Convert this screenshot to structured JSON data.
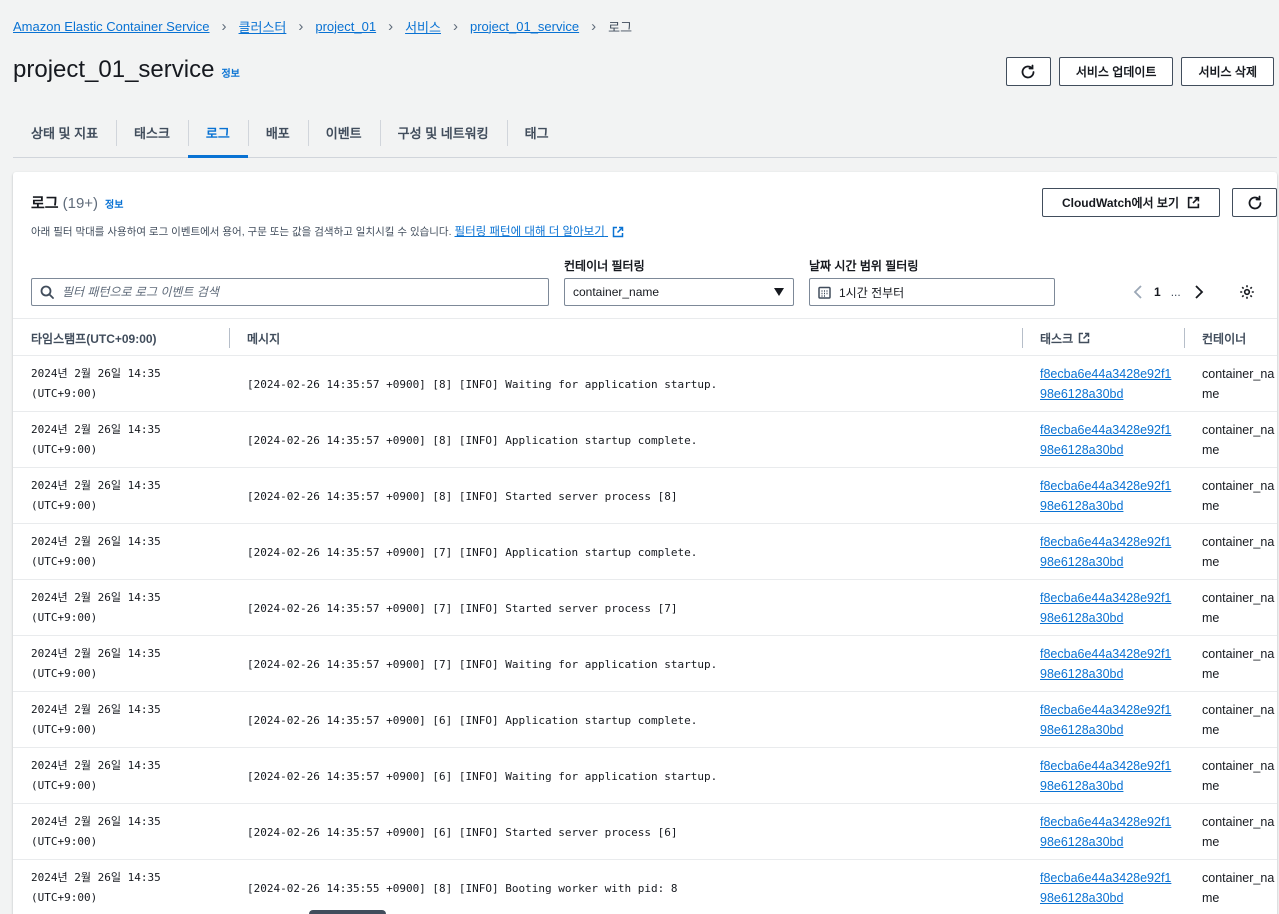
{
  "breadcrumb": {
    "items": [
      "Amazon Elastic Container Service",
      "클러스터",
      "project_01",
      "서비스",
      "project_01_service"
    ],
    "current": "로그"
  },
  "page": {
    "title": "project_01_service",
    "info": "정보"
  },
  "header_actions": {
    "update": "서비스 업데이트",
    "delete": "서비스 삭제"
  },
  "tabs": [
    "상태 및 지표",
    "태스크",
    "로그",
    "배포",
    "이벤트",
    "구성 및 네트워킹",
    "태그"
  ],
  "active_tab": "로그",
  "logs": {
    "title": "로그",
    "count": "(19+)",
    "info": "정보",
    "description": "아래 필터 막대를 사용하여 로그 이벤트에서 용어, 구문 또는 값을 검색하고 일치시킬 수 있습니다.",
    "learn_more": "필터링 패턴에 대해 더 알아보기",
    "cloudwatch_button": "CloudWatch에서 보기",
    "search_placeholder": "필터 패턴으로 로그 이벤트 검색",
    "container_filter_label": "컨테이너 필터링",
    "container_filter_value": "container_name",
    "date_filter_label": "날짜 시간 범위 필터링",
    "date_filter_value": "1시간 전부터",
    "pagination": {
      "page": "1",
      "dots": "..."
    },
    "columns": {
      "timestamp": "타임스탬프(UTC+09:00)",
      "message": "메시지",
      "task": "태스크",
      "container": "컨테이너"
    },
    "rows": [
      {
        "date": "2024년 2월 26일 14:35",
        "tz": "(UTC+9:00)",
        "message": "[2024-02-26 14:35:57 +0900] [8] [INFO] Waiting for application startup.",
        "task": "f8ecba6e44a3428e92f198e6128a30bd",
        "container": "container_name"
      },
      {
        "date": "2024년 2월 26일 14:35",
        "tz": "(UTC+9:00)",
        "message": "[2024-02-26 14:35:57 +0900] [8] [INFO] Application startup complete.",
        "task": "f8ecba6e44a3428e92f198e6128a30bd",
        "container": "container_name"
      },
      {
        "date": "2024년 2월 26일 14:35",
        "tz": "(UTC+9:00)",
        "message": "[2024-02-26 14:35:57 +0900] [8] [INFO] Started server process [8]",
        "task": "f8ecba6e44a3428e92f198e6128a30bd",
        "container": "container_name"
      },
      {
        "date": "2024년 2월 26일 14:35",
        "tz": "(UTC+9:00)",
        "message": "[2024-02-26 14:35:57 +0900] [7] [INFO] Application startup complete.",
        "task": "f8ecba6e44a3428e92f198e6128a30bd",
        "container": "container_name"
      },
      {
        "date": "2024년 2월 26일 14:35",
        "tz": "(UTC+9:00)",
        "message": "[2024-02-26 14:35:57 +0900] [7] [INFO] Started server process [7]",
        "task": "f8ecba6e44a3428e92f198e6128a30bd",
        "container": "container_name"
      },
      {
        "date": "2024년 2월 26일 14:35",
        "tz": "(UTC+9:00)",
        "message": "[2024-02-26 14:35:57 +0900] [7] [INFO] Waiting for application startup.",
        "task": "f8ecba6e44a3428e92f198e6128a30bd",
        "container": "container_name"
      },
      {
        "date": "2024년 2월 26일 14:35",
        "tz": "(UTC+9:00)",
        "message": "[2024-02-26 14:35:57 +0900] [6] [INFO] Application startup complete.",
        "task": "f8ecba6e44a3428e92f198e6128a30bd",
        "container": "container_name"
      },
      {
        "date": "2024년 2월 26일 14:35",
        "tz": "(UTC+9:00)",
        "message": "[2024-02-26 14:35:57 +0900] [6] [INFO] Waiting for application startup.",
        "task": "f8ecba6e44a3428e92f198e6128a30bd",
        "container": "container_name"
      },
      {
        "date": "2024년 2월 26일 14:35",
        "tz": "(UTC+9:00)",
        "message": "[2024-02-26 14:35:57 +0900] [6] [INFO] Started server process [6]",
        "task": "f8ecba6e44a3428e92f198e6128a30bd",
        "container": "container_name"
      },
      {
        "date": "2024년 2월 26일 14:35",
        "tz": "(UTC+9:00)",
        "message": "[2024-02-26 14:35:55 +0900] [8] [INFO] Booting worker with pid: 8",
        "task": "f8ecba6e44a3428e92f198e6128a30bd",
        "container": "container_name"
      }
    ]
  },
  "icons": {
    "refresh": "refresh-icon",
    "external": "external-link-icon",
    "search": "search-icon",
    "caret": "caret-down-icon",
    "calendar": "calendar-icon",
    "settings": "gear-icon"
  },
  "colors": {
    "link": "#0972d3",
    "text": "#16191f",
    "background": "#f2f3f3"
  }
}
